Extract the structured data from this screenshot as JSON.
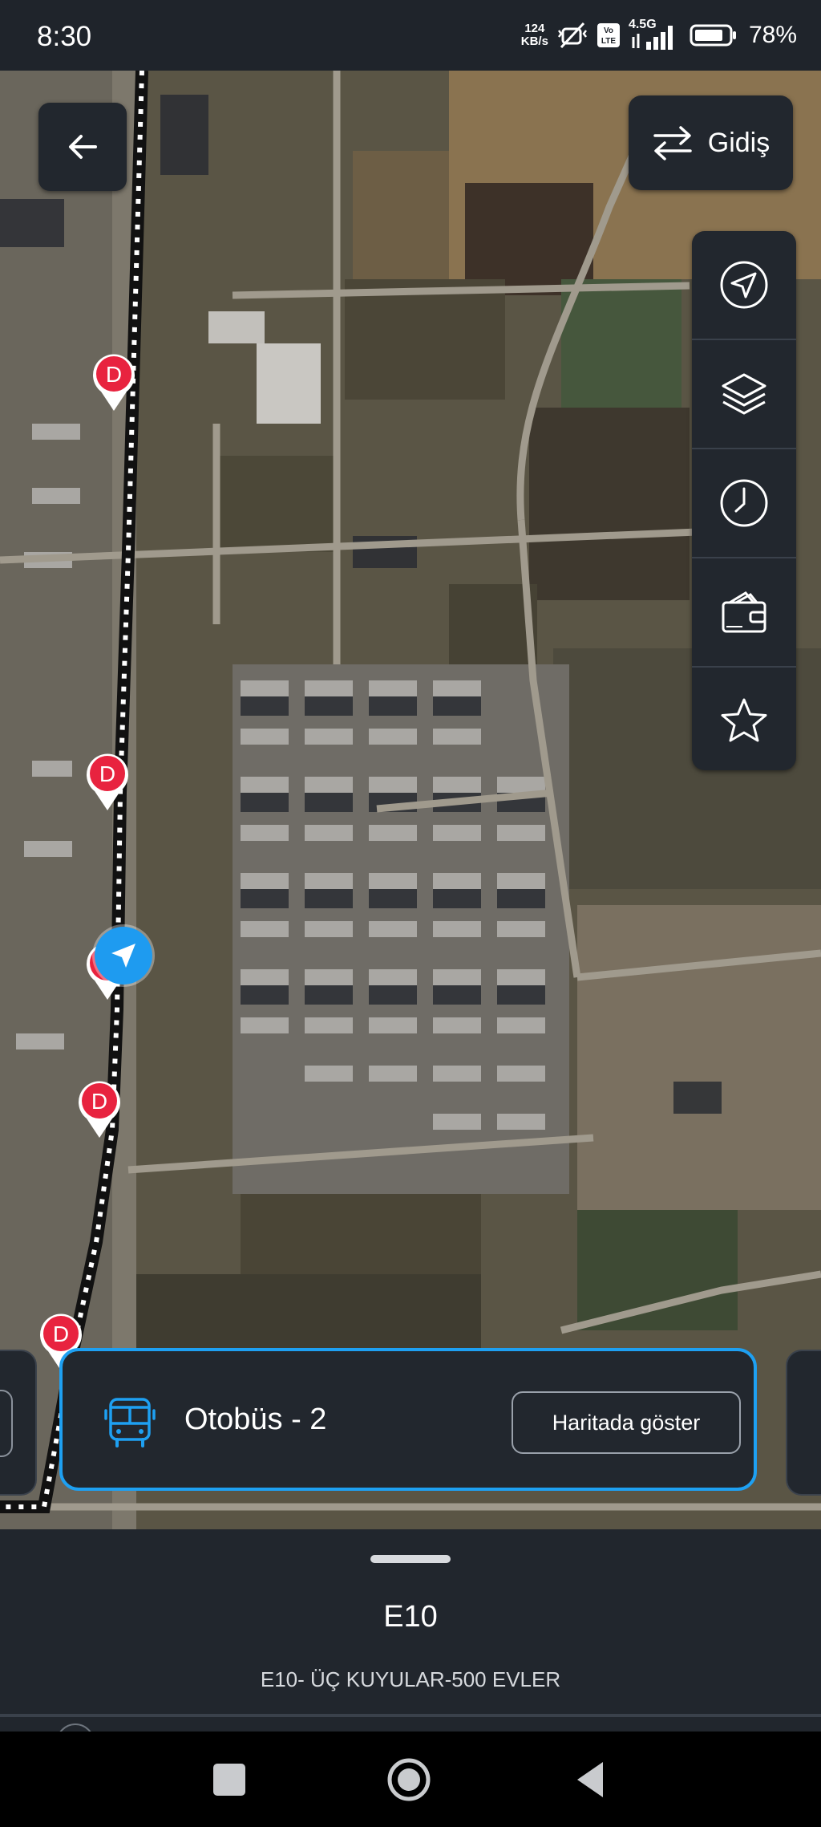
{
  "status_bar": {
    "time": "8:30",
    "net_speed_value": "124",
    "net_speed_unit": "KB/s",
    "network_type": "4.5G",
    "volte_label": "Vo LTE",
    "battery_percent": "78%",
    "icons": [
      "mute-vibrate-icon",
      "volte-icon",
      "signal-icon",
      "battery-icon"
    ]
  },
  "map": {
    "back_icon": "arrow-left-icon",
    "direction_button": {
      "label": "Gidiş",
      "icon": "swap-arrows-icon"
    },
    "toolbar": [
      "navigation-icon",
      "layers-icon",
      "clock-icon",
      "wallet-icon",
      "star-icon"
    ],
    "stop_marker_label": "D",
    "stop_marker_color": "#e8233f",
    "route_line_color": "#111111",
    "location_marker_color": "#1e9bf0"
  },
  "vehicle_card": {
    "name": "Otobüs - 2",
    "button": "Haritada göster",
    "accent": "#1ea0f2"
  },
  "route": {
    "code": "E10",
    "name": "E10- ÜÇ KUYULAR-500 EVLER"
  }
}
